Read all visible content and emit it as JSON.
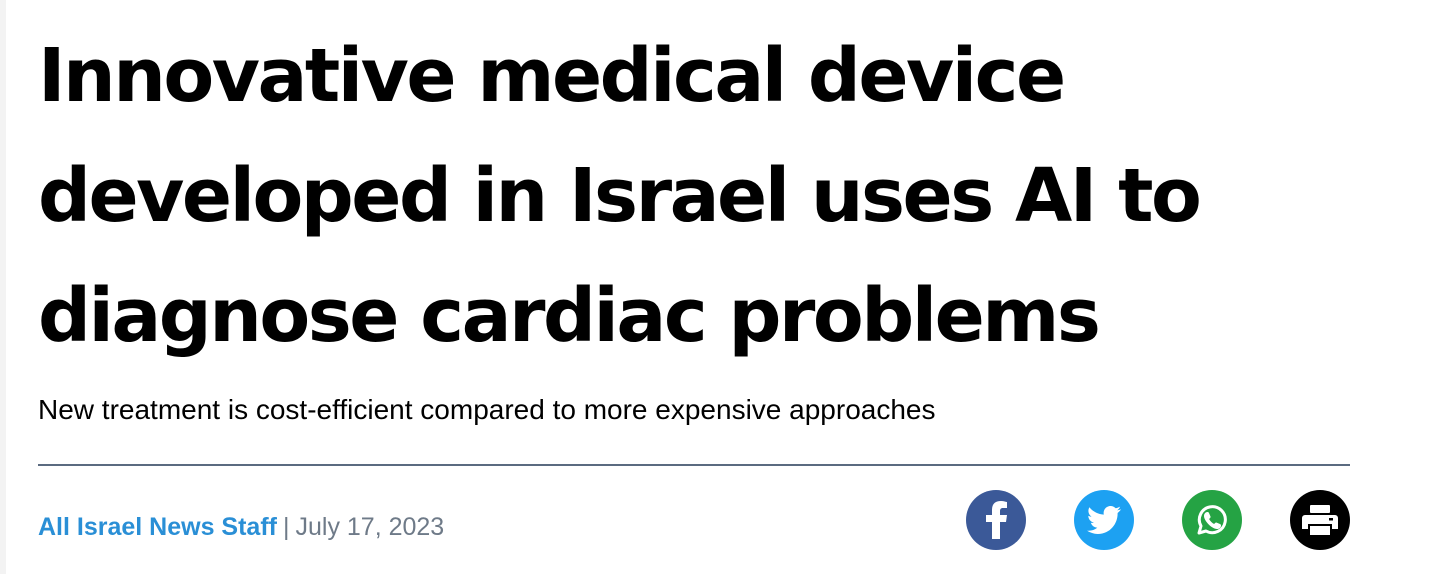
{
  "article": {
    "headline": "Innovative medical device developed in Israel uses AI to diagnose cardiac problems",
    "subheadline": "New treatment is cost-efficient compared to more expensive approaches",
    "author": "All Israel News Staff",
    "separator": "|",
    "date": "July 17, 2023"
  },
  "share": {
    "buttons": [
      {
        "icon": "facebook-icon",
        "color": "#3b5998"
      },
      {
        "icon": "twitter-icon",
        "color": "#1da1f2"
      },
      {
        "icon": "whatsapp-icon",
        "color": "#25a344"
      },
      {
        "icon": "print-icon",
        "color": "#000000"
      }
    ]
  },
  "colors": {
    "headline": "#000000",
    "author": "#2a8fd6",
    "date": "#6e7a88",
    "divider": "#5b6b80"
  }
}
